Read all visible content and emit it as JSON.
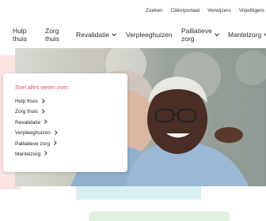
{
  "utility_nav": [
    "Zoeken",
    "Cliëntportaal",
    "Verwijzers",
    "Vrijwilligers"
  ],
  "main_nav": [
    {
      "label_line1": "Hulp",
      "label_line2": "thuis"
    },
    {
      "label_line1": "Zorg",
      "label_line2": "thuis"
    },
    {
      "label_line1": "Revalidatie",
      "label_line2": ""
    },
    {
      "label_line1": "Verpleeghuizen",
      "label_line2": ""
    },
    {
      "label_line1": "Palliatieve",
      "label_line2": "zorg"
    },
    {
      "label_line1": "Mantelzorg",
      "label_line2": ""
    }
  ],
  "card": {
    "title": "Snel alles weten over:",
    "items": [
      "Hulp thuis",
      "Zorg thuis",
      "Revalidatie",
      "Verpleeghuizen",
      "Palliatieve zorg",
      "Mantelzorg"
    ]
  },
  "colors": {
    "accent": "#e2515e",
    "pink_block": "#fbe3e4",
    "teal_block": "#d8efef",
    "green_block": "#e1f1e1"
  },
  "icons": {
    "nav_dropdown": "chevron-down-icon",
    "list_arrow": "chevron-right-icon"
  }
}
